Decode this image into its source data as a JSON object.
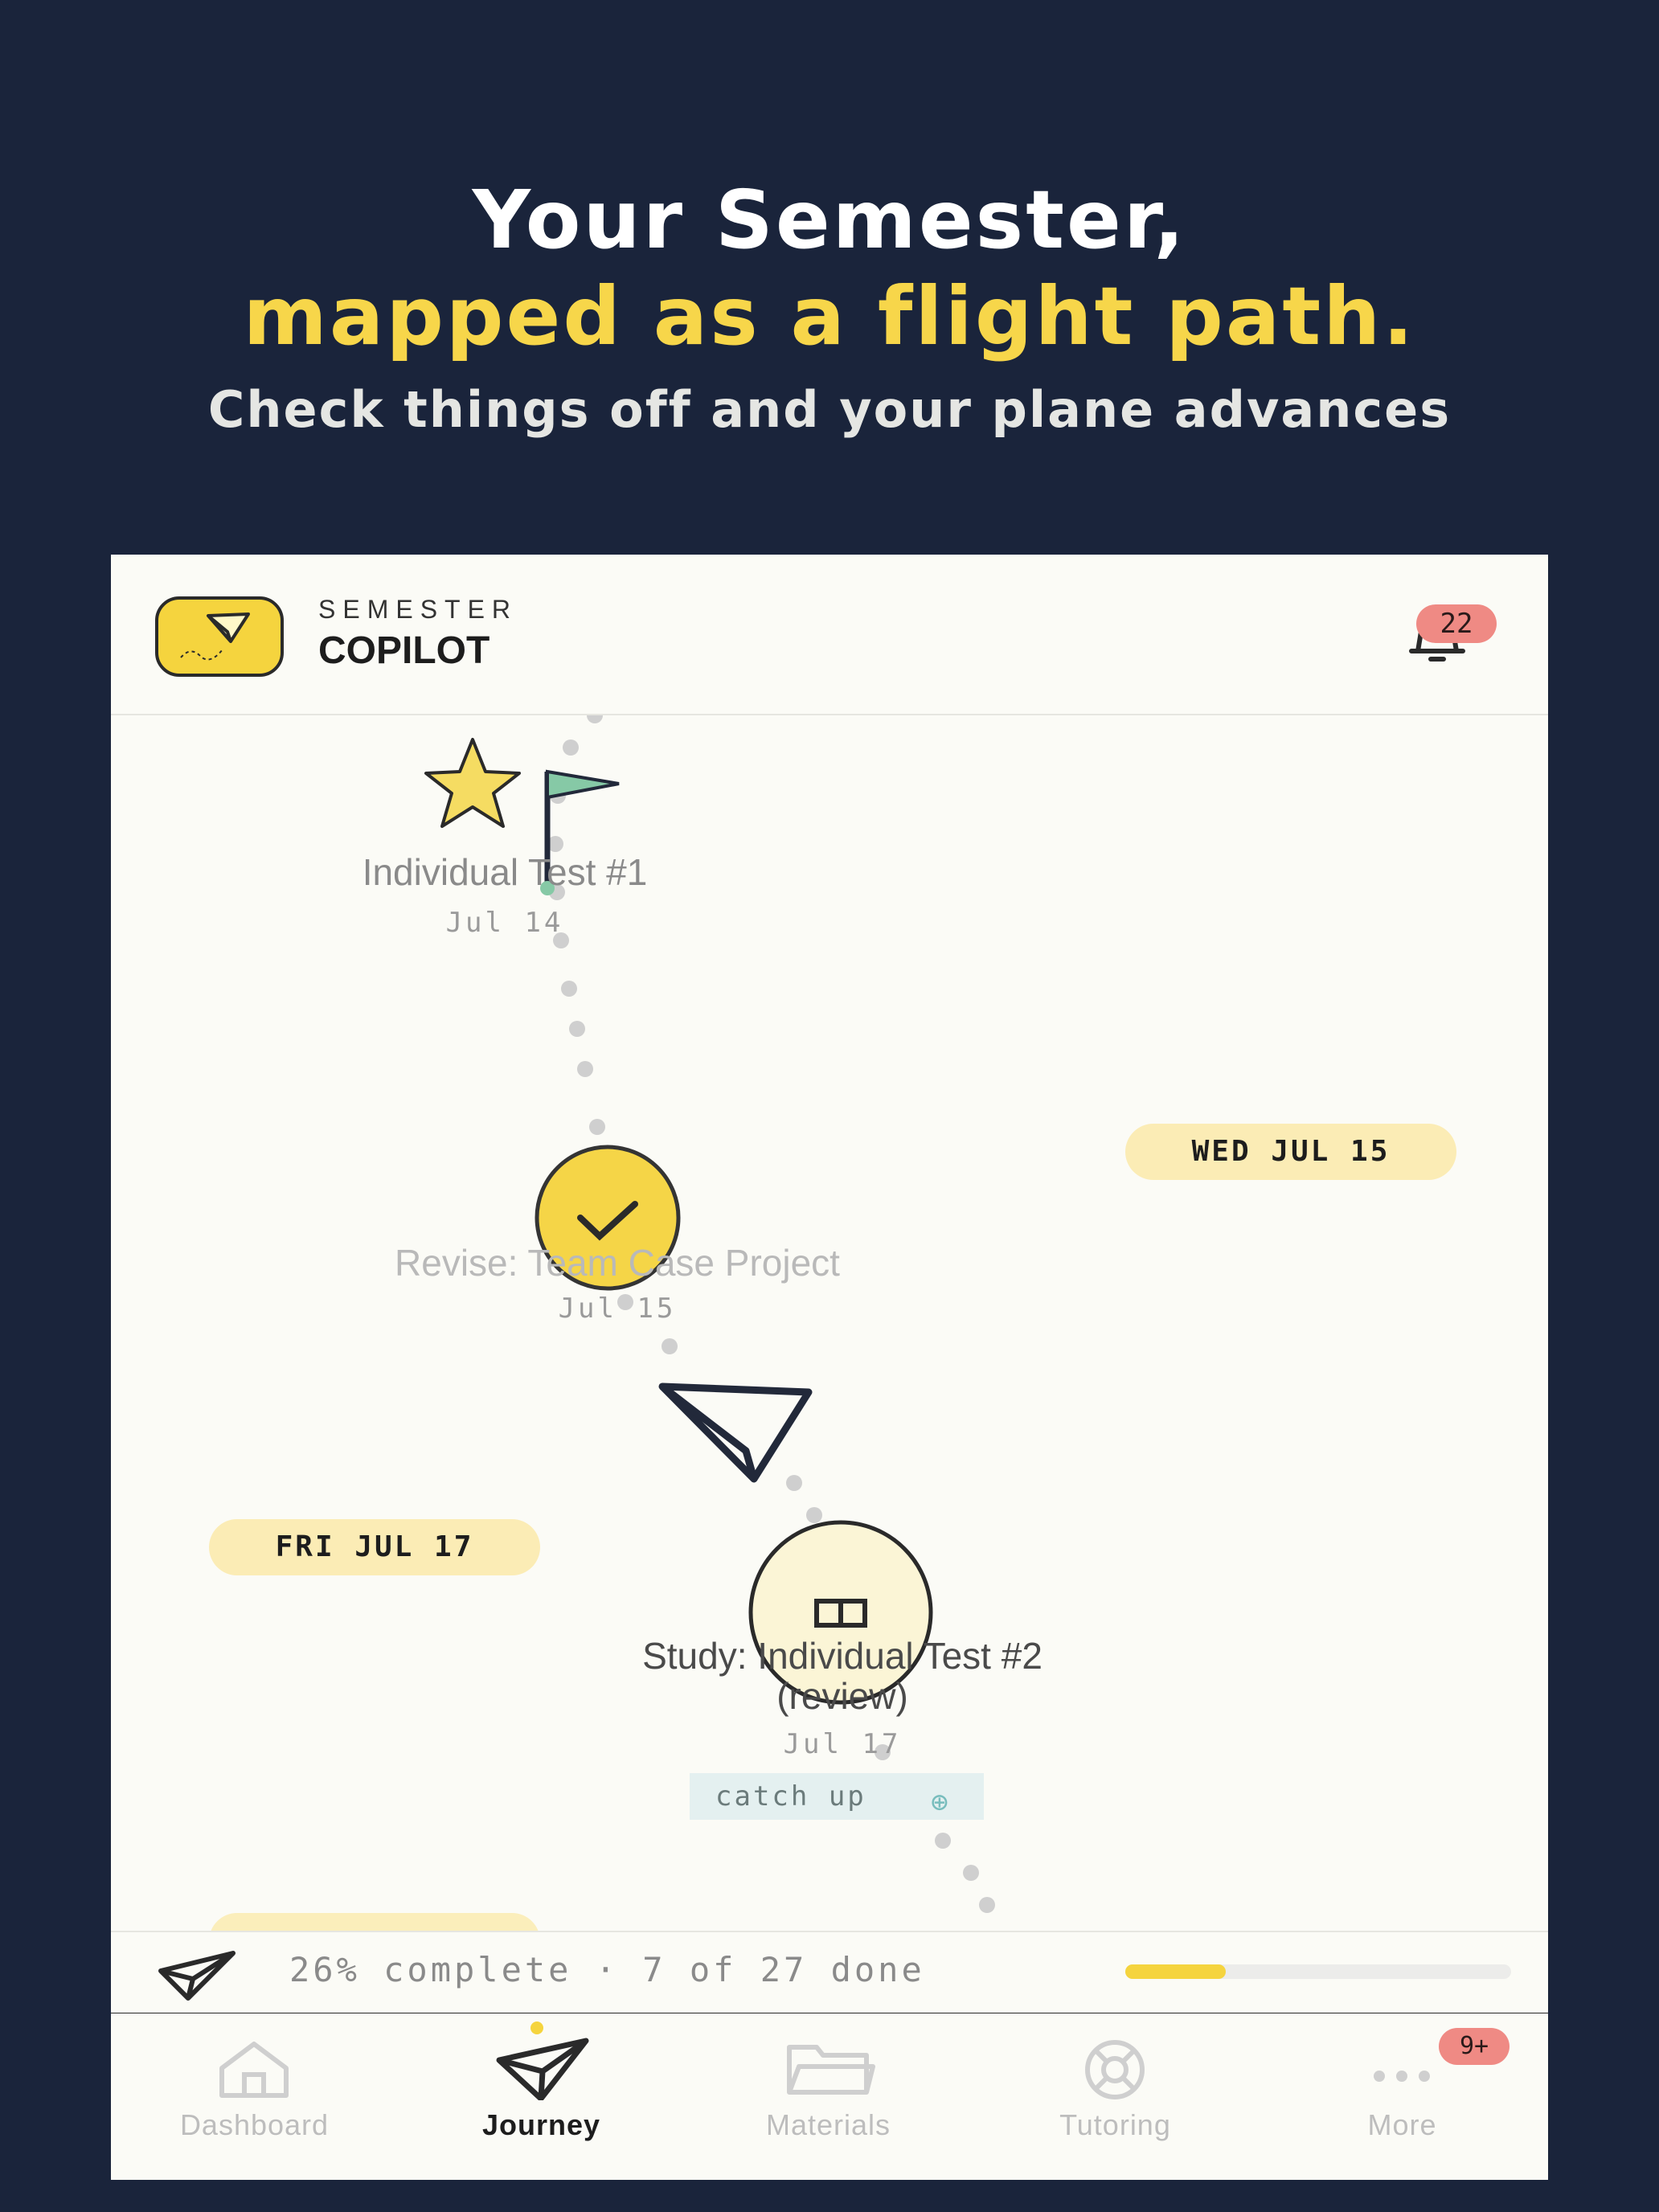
{
  "hero": {
    "line1": "Your Semester,",
    "line2": "mapped as a flight path.",
    "subtitle": "Check things off and your plane advances"
  },
  "header": {
    "brand_top": "SEMESTER",
    "brand_main": "COPILOT",
    "notification_count": "22"
  },
  "timeline": {
    "date_pills": [
      "WED JUL 15",
      "FRI JUL 17"
    ],
    "tasks": [
      {
        "title": "Individual Test #1",
        "date": "Jul 14",
        "icon": "flag-icon",
        "status": "done"
      },
      {
        "title": "Revise: Team Case Project",
        "date": "Jul 15",
        "icon": "check-icon",
        "status": "done"
      },
      {
        "title": "Study: Individual Test #2 (review)",
        "title_line1": "Study: Individual Test #2",
        "title_line2": "(review)",
        "date": "Jul 17",
        "icon": "book-icon",
        "status": "current",
        "tag": "catch up"
      }
    ]
  },
  "progress": {
    "text": "26% complete · 7 of 27 done",
    "fraction": 0.26
  },
  "tabs": [
    {
      "label": "Dashboard",
      "icon": "home-icon",
      "active": false
    },
    {
      "label": "Journey",
      "icon": "paper-plane-icon",
      "active": true
    },
    {
      "label": "Materials",
      "icon": "folder-icon",
      "active": false
    },
    {
      "label": "Tutoring",
      "icon": "lifebuoy-icon",
      "active": false
    },
    {
      "label": "More",
      "icon": "more-dots-icon",
      "active": false,
      "badge": "9+"
    }
  ],
  "colors": {
    "background": "#1a243b",
    "accent": "#f7d64a",
    "badge": "#ef8a84",
    "flag": "#7fc2a3"
  }
}
